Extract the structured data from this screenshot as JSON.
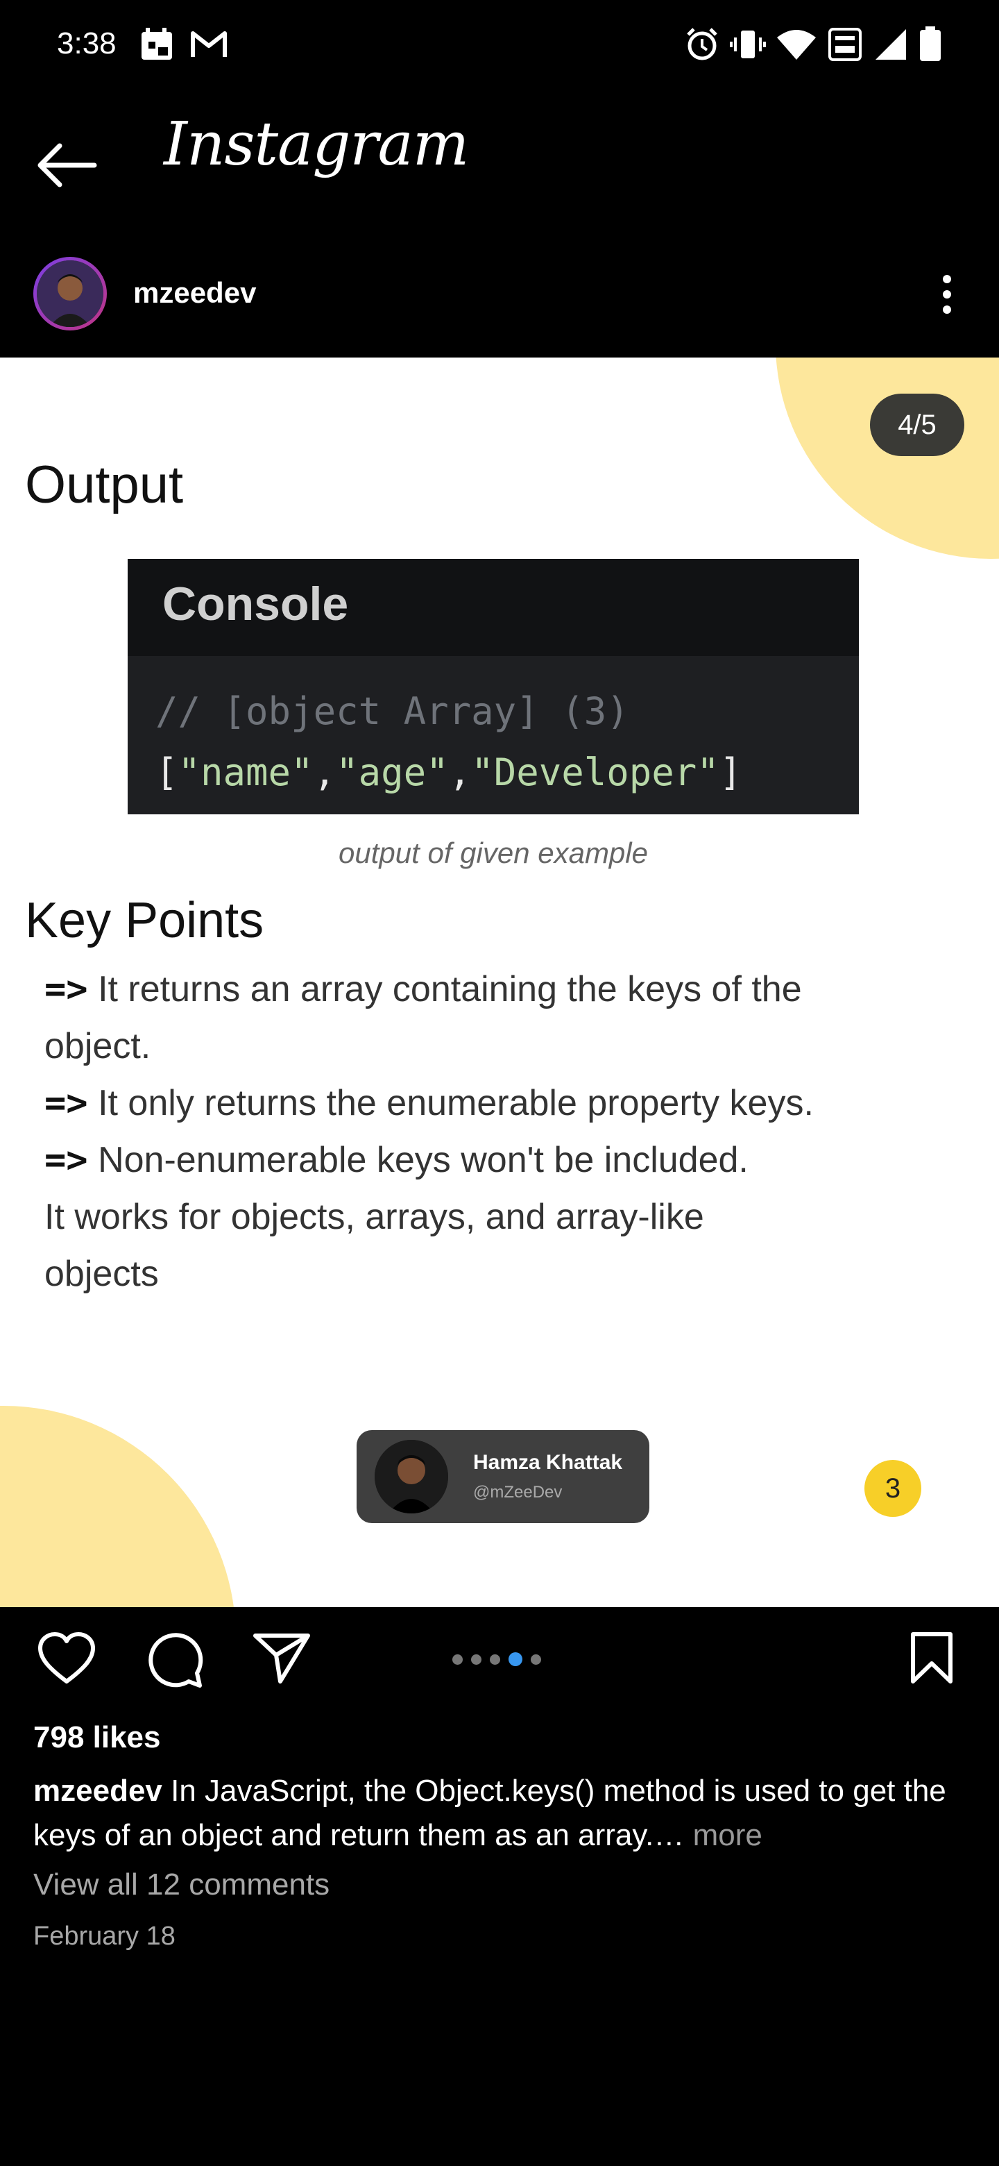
{
  "status_bar": {
    "time": "3:38",
    "left_icons": [
      "calendar-icon",
      "gmail-icon"
    ],
    "right_icons": [
      "alarm-icon",
      "vibrate-icon",
      "wifi-icon",
      "volte-icon",
      "signal-icon",
      "battery-icon"
    ]
  },
  "header": {
    "back_icon": "arrow-left-icon",
    "title": "Instagram"
  },
  "post_header": {
    "username": "mzeedev",
    "more_icon": "vertical-dots-icon"
  },
  "post_image": {
    "page_indicator": "4/5",
    "output_heading": "Output",
    "console_title": "Console",
    "console_comment": "// [object Array] (3)",
    "console_result": {
      "open": "[",
      "items": [
        "\"name\"",
        "\"age\"",
        "\"Developer\""
      ],
      "sep": ",",
      "close": "]"
    },
    "caption": "output of given example",
    "key_points_heading": "Key Points",
    "arrow": "=>",
    "key_points": [
      "It returns an array containing the keys of the",
      "object.",
      "It only returns the enumerable property keys.",
      "Non-enumerable keys won't be included.",
      "It works for objects, arrays, and array-like",
      "objects"
    ],
    "author_name": "Hamza Khattak",
    "author_handle": "@mZeeDev",
    "slide_number": "3"
  },
  "actions": {
    "icons": [
      "heart-icon",
      "comment-icon",
      "share-icon",
      "bookmark-icon"
    ],
    "carousel_total": 5,
    "carousel_active_index": 3
  },
  "likes": "798 likes",
  "caption": {
    "username": "mzeedev",
    "text": " In JavaScript, the Object.keys() method is used to get the keys of an object and return them as an array.…",
    "more": " more"
  },
  "view_comments": "View all 12 comments",
  "date": "February 18",
  "colors": {
    "accent_blue": "#3897f0",
    "blob_yellow": "#fde79c",
    "badge_yellow": "#f7cf28"
  }
}
